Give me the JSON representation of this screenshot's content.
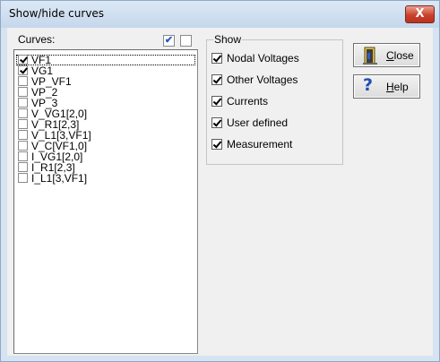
{
  "window": {
    "title": "Show/hide curves",
    "close_glyph": "X"
  },
  "curves": {
    "label": "Curves:",
    "check_all_glyph": "✔",
    "items": [
      {
        "label": "VF1",
        "checked": true
      },
      {
        "label": "VG1",
        "checked": true
      },
      {
        "label": "VP_VF1",
        "checked": false
      },
      {
        "label": "VP_2",
        "checked": false
      },
      {
        "label": "VP_3",
        "checked": false
      },
      {
        "label": "V_VG1[2,0]",
        "checked": false
      },
      {
        "label": "V_R1[2,3]",
        "checked": false
      },
      {
        "label": "V_L1[3,VF1]",
        "checked": false
      },
      {
        "label": "V_C[VF1,0]",
        "checked": false
      },
      {
        "label": "I_VG1[2,0]",
        "checked": false
      },
      {
        "label": "I_R1[2,3]",
        "checked": false
      },
      {
        "label": "I_L1[3,VF1]",
        "checked": false
      }
    ]
  },
  "show": {
    "legend": "Show",
    "options": [
      {
        "label": "Nodal Voltages",
        "checked": true
      },
      {
        "label": "Other Voltages",
        "checked": true
      },
      {
        "label": "Currents",
        "checked": true
      },
      {
        "label": "User defined",
        "checked": true
      },
      {
        "label": "Measurement",
        "checked": true
      }
    ]
  },
  "buttons": {
    "close": {
      "label_first": "C",
      "label_rest": "lose",
      "icon": "door-exit-icon"
    },
    "help": {
      "label_first": "H",
      "label_rest": "elp",
      "icon": "question-mark-icon",
      "glyph": "?"
    }
  }
}
